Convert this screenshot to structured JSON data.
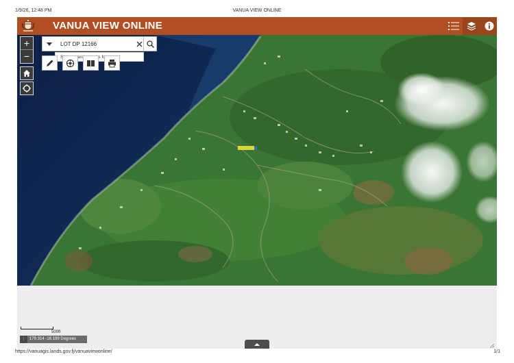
{
  "print": {
    "datetime": "1/9/26, 12:48 PM",
    "page_title": "VANUA VIEW ONLINE",
    "url": "https://vanuagis.lands.gov.fj/vanuaviewonline/",
    "page_number": "1/1"
  },
  "header": {
    "title": "VANUA VIEW ONLINE",
    "color": "#b14f22",
    "buttons": [
      "list-icon",
      "layers-icon",
      "info-icon"
    ]
  },
  "map_controls": {
    "zoom_in": "+",
    "zoom_out": "−"
  },
  "search": {
    "query": "LOT DP 12166",
    "suggestion": "Show search results for"
  },
  "tools": [
    "pencil-icon",
    "measure-icon",
    "compare-icon",
    "print-icon"
  ],
  "scale": {
    "label": "500ft"
  },
  "coordinates": {
    "value": "179.314 -16.199 Degrees"
  }
}
